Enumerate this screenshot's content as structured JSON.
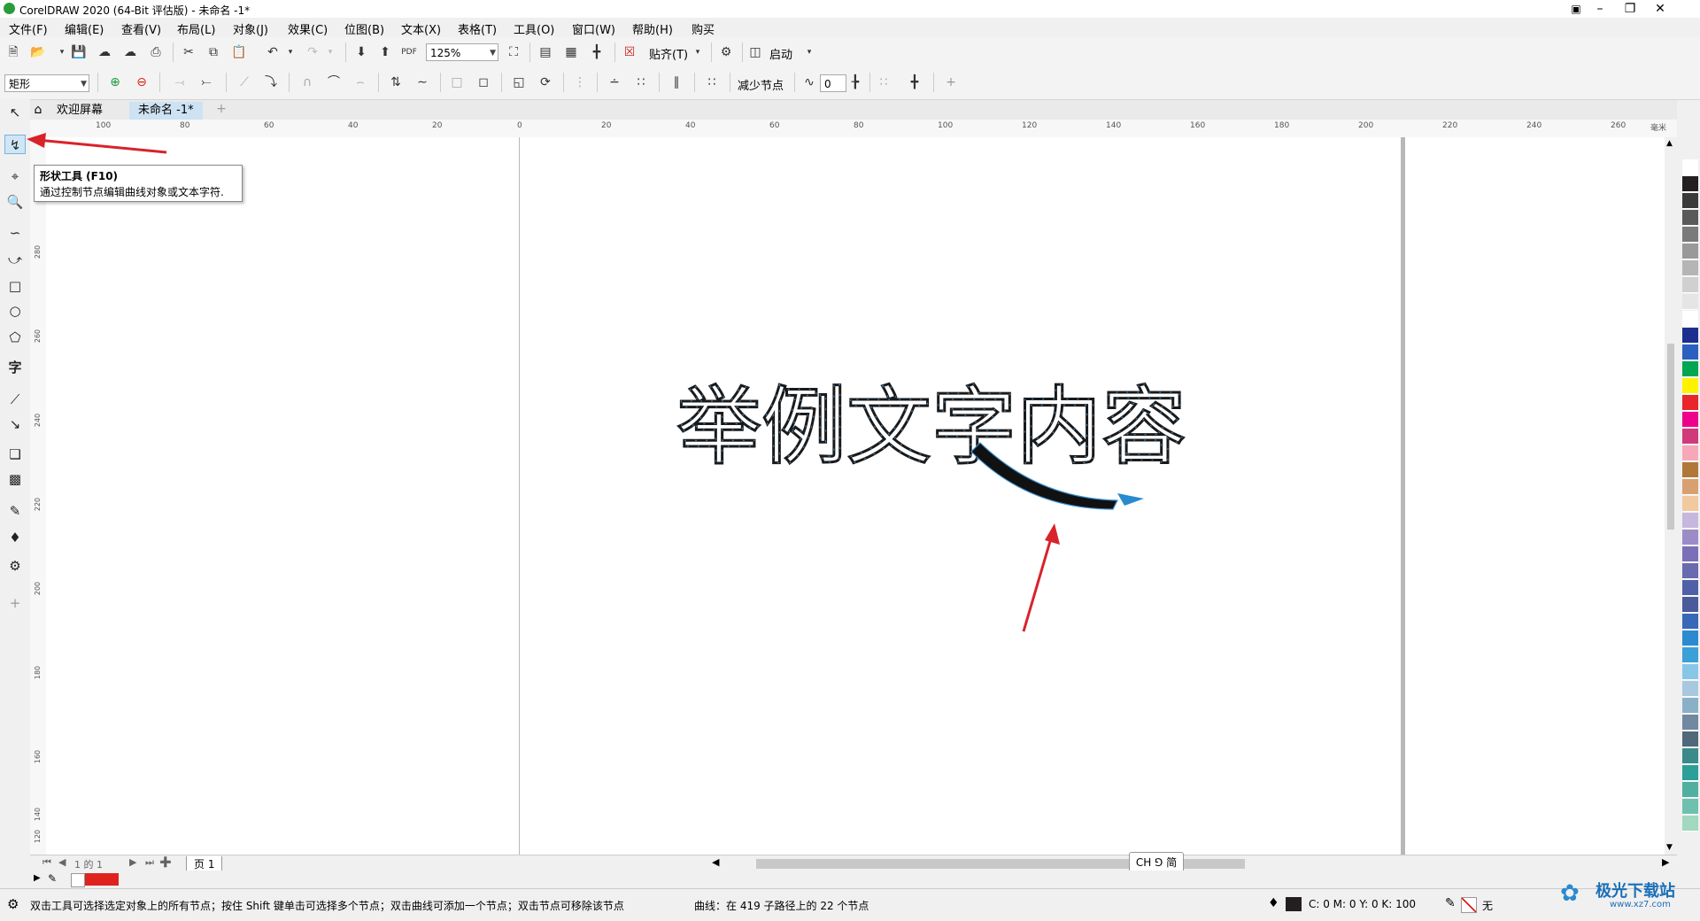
{
  "window": {
    "title": "CorelDRAW 2020 (64-Bit 评估版) - 未命名 -1*"
  },
  "menu": [
    "文件(F)",
    "编辑(E)",
    "查看(V)",
    "布局(L)",
    "对象(J)",
    "效果(C)",
    "位图(B)",
    "文本(X)",
    "表格(T)",
    "工具(O)",
    "窗口(W)",
    "帮助(H)",
    "购买"
  ],
  "std_toolbar": {
    "zoom": "125%",
    "snap_label": "贴齐(T)",
    "launch_label": "启动"
  },
  "prop_toolbar": {
    "shape_select": "矩形",
    "reduce_nodes_label": "减少节点",
    "smoothness": "0"
  },
  "tabs": {
    "welcome": "欢迎屏幕",
    "doc": "未命名 -1*"
  },
  "ruler_h": [
    "100",
    "80",
    "60",
    "40",
    "20",
    "0",
    "20",
    "40",
    "60",
    "80",
    "100",
    "120",
    "140",
    "160",
    "180",
    "200",
    "220",
    "240",
    "260",
    "毫米"
  ],
  "ruler_v": [
    "280",
    "260",
    "240",
    "220",
    "200",
    "180",
    "160",
    "140",
    "120"
  ],
  "tooltip": {
    "title": "形状工具 (F10)",
    "desc": "通过控制节点编辑曲线对象或文本字符."
  },
  "canvas_text": "举例文字内容",
  "page_nav": {
    "count": "1 的 1",
    "page_label": "页 1"
  },
  "lang_indicator": "CH ⅁ 简",
  "status": {
    "hint": "双击工具可选择选定对象上的所有节点；按住 Shift 键单击可选择多个节点；双击曲线可添加一个节点；双击节点可移除该节点",
    "curve_info": "曲线：在 419 子路径上的 22 个节点",
    "cmyk": "C: 0 M: 0 Y: 0 K: 100",
    "outline": "无"
  },
  "watermark": {
    "text": "极光下载站",
    "url": "www.xz7.com"
  },
  "palette_colors": [
    "#ffffff",
    "#231f20",
    "#3a3a3a",
    "#5a5a5a",
    "#7a7a7a",
    "#999999",
    "#b5b5b5",
    "#d0d0d0",
    "#e5e5e5",
    "#ffffff",
    "#1c2f8f",
    "#2a60c0",
    "#00a651",
    "#fff200",
    "#e8262b",
    "#ec008c",
    "#d13a7a",
    "#f7a8b8",
    "#b07838",
    "#d8a070",
    "#f2c89e",
    "#c5b8dc",
    "#9b8cc8",
    "#7b70b8",
    "#6a6ab0",
    "#5060a8",
    "#4a5a9a",
    "#3868b8",
    "#2b8ad0",
    "#3aa0d8",
    "#88c6e8",
    "#a8c8e0",
    "#8ab0c8",
    "#7088a0",
    "#506878",
    "#3a8a8a",
    "#2aa098",
    "#50b0a0",
    "#70c0b0",
    "#a0d8c0"
  ]
}
